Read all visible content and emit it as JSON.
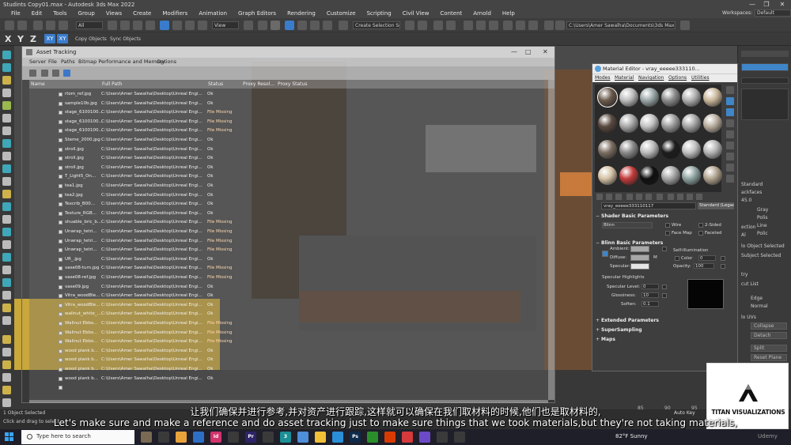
{
  "window": {
    "title": "Studints Copy01.max - Autodesk 3ds Max 2022",
    "controls": [
      "—",
      "❐",
      "✕"
    ]
  },
  "menubar": {
    "items": [
      "File",
      "Edit",
      "Tools",
      "Group",
      "Views",
      "Create",
      "Modifiers",
      "Animation",
      "Graph Editors",
      "Rendering",
      "Customize",
      "Scripting",
      "Civil View",
      "Content",
      "Arnold",
      "Help"
    ],
    "workspaces_label": "Workspaces:",
    "workspace_value": "Default"
  },
  "toolbar": {
    "selection_filter": "All",
    "view_dropdown": "View",
    "selection_set": "Create Selection Se",
    "project_path": "C:\\Users\\Amer Sawalha\\Documents\\3ds Max 2022"
  },
  "toolbar2": {
    "axes": [
      "X",
      "Y",
      "Z"
    ],
    "xy_buttons": [
      "XY",
      "XY"
    ],
    "tabs": [
      "Copy Objects",
      "Sync Objects"
    ]
  },
  "asset_tracking": {
    "title": "Asset Tracking",
    "menu": [
      "Server",
      "File",
      "Paths",
      "Bitmap Performance and Memory",
      "Options"
    ],
    "columns": [
      "Name",
      "Full Path",
      "Status",
      "Proxy Resol...",
      "Proxy Status"
    ],
    "rows": [
      {
        "name": "rtom_ref.jpg",
        "path": "C:\\Users\\Amer Sawalha\\Desktop\\Unreal Engi...",
        "status": "Ok"
      },
      {
        "name": "sample10b.jpg",
        "path": "C:\\Users\\Amer Sawalha\\Desktop\\Unreal Engi...",
        "status": "Ok"
      },
      {
        "name": "stage_6100100...",
        "path": "C:\\Users\\Amer Sawalha\\Desktop\\Unreal Engi...",
        "status": "File Missing"
      },
      {
        "name": "stage_6100100...",
        "path": "C:\\Users\\Amer Sawalha\\Desktop\\Unreal Engi...",
        "status": "File Missing"
      },
      {
        "name": "stage_6100100...",
        "path": "C:\\Users\\Amer Sawalha\\Desktop\\Unreal Engi...",
        "status": "File Missing"
      },
      {
        "name": "Steme_2000.jpg",
        "path": "C:\\Users\\Amer Sawalha\\Desktop\\Unreal Engi...",
        "status": "Ok"
      },
      {
        "name": "stroll.jpg",
        "path": "C:\\Users\\Amer Sawalha\\Desktop\\Unreal Engi...",
        "status": "Ok"
      },
      {
        "name": "stroll.jpg",
        "path": "C:\\Users\\Amer Sawalha\\Desktop\\Unreal Engi...",
        "status": "Ok"
      },
      {
        "name": "stroll.jpg",
        "path": "C:\\Users\\Amer Sawalha\\Desktop\\Unreal Engi...",
        "status": "Ok"
      },
      {
        "name": "T_Light5_On...",
        "path": "C:\\Users\\Amer Sawalha\\Desktop\\Unreal Engi...",
        "status": "Ok"
      },
      {
        "name": "tea1.jpg",
        "path": "C:\\Users\\Amer Sawalha\\Desktop\\Unreal Engi...",
        "status": "Ok"
      },
      {
        "name": "tea2.jpg",
        "path": "C:\\Users\\Amer Sawalha\\Desktop\\Unreal Engi...",
        "status": "Ok"
      },
      {
        "name": "Texcrib_B00...",
        "path": "C:\\Users\\Amer Sawalha\\Desktop\\Unreal Engi...",
        "status": "Ok"
      },
      {
        "name": "Texture_RGB...",
        "path": "C:\\Users\\Amer Sawalha\\Desktop\\Unreal Engi...",
        "status": "Ok"
      },
      {
        "name": "shuable_bric_b...",
        "path": "C:\\Users\\Amer Sawalha\\Desktop\\Unreal Engi...",
        "status": "File Missing"
      },
      {
        "name": "Unwrap_tetri...",
        "path": "C:\\Users\\Amer Sawalha\\Desktop\\Unreal Engi...",
        "status": "File Missing"
      },
      {
        "name": "Unwrap_tetri...",
        "path": "C:\\Users\\Amer Sawalha\\Desktop\\Unreal Engi...",
        "status": "File Missing"
      },
      {
        "name": "Unwrap_tetri...",
        "path": "C:\\Users\\Amer Sawalha\\Desktop\\Unreal Engi...",
        "status": "File Missing"
      },
      {
        "name": "UR_.jpg",
        "path": "C:\\Users\\Amer Sawalha\\Desktop\\Unreal Engi...",
        "status": "Ok"
      },
      {
        "name": "vase08-turn.jpg",
        "path": "C:\\Users\\Amer Sawalha\\Desktop\\Unreal Engi...",
        "status": "File Missing"
      },
      {
        "name": "vase08-ref.jpg",
        "path": "C:\\Users\\Amer Sawalha\\Desktop\\Unreal Engi...",
        "status": "File Missing"
      },
      {
        "name": "vase09.jpg",
        "path": "C:\\Users\\Amer Sawalha\\Desktop\\Unreal Engi...",
        "status": "Ok"
      },
      {
        "name": "Vitra_woodBle...",
        "path": "C:\\Users\\Amer Sawalha\\Desktop\\Unreal Engi...",
        "status": "Ok"
      },
      {
        "name": "Vitra_woodBle...",
        "path": "C:\\Users\\Amer Sawalha\\Desktop\\Unreal Engi...",
        "status": "Ok"
      },
      {
        "name": "wallnut_white_...",
        "path": "C:\\Users\\Amer Sawalha\\Desktop\\Unreal Engi...",
        "status": "Ok"
      },
      {
        "name": "Wallnut Ebbo...",
        "path": "C:\\Users\\Amer Sawalha\\Desktop\\Unreal Engi...",
        "status": "File Missing"
      },
      {
        "name": "Wallnut Ebbo...",
        "path": "C:\\Users\\Amer Sawalha\\Desktop\\Unreal Engi...",
        "status": "File Missing"
      },
      {
        "name": "Wallnut Ebbo...",
        "path": "C:\\Users\\Amer Sawalha\\Desktop\\Unreal Engi...",
        "status": "File Missing"
      },
      {
        "name": "wood plank b...",
        "path": "C:\\Users\\Amer Sawalha\\Desktop\\Unreal Engi...",
        "status": "Ok"
      },
      {
        "name": "wood plank b...",
        "path": "C:\\Users\\Amer Sawalha\\Desktop\\Unreal Engi...",
        "status": "Ok"
      },
      {
        "name": "wood plank b...",
        "path": "C:\\Users\\Amer Sawalha\\Desktop\\Unreal Engi...",
        "status": "Ok"
      },
      {
        "name": "wood plank b...",
        "path": "C:\\Users\\Amer Sawalha\\Desktop\\Unreal Engi...",
        "status": "Ok"
      },
      {
        "name": "",
        "path": "",
        "status": ""
      }
    ]
  },
  "material_editor": {
    "title": "Material Editor - vray_eeeee333110...",
    "menu": [
      "Modes",
      "Material",
      "Navigation",
      "Options",
      "Utilities"
    ],
    "material_name": "vray_eeeee333110117",
    "material_type": "Standard (Legacy)",
    "rollouts": {
      "shader_basic": "Shader Basic Parameters",
      "blinn_basic": "Blinn Basic Parameters",
      "extended": "Extended Parameters",
      "supersampling": "SuperSampling",
      "maps": "Maps"
    },
    "shader": {
      "type": "Blinn",
      "wire": "Wire",
      "two_sided": "2-Sided",
      "face_map": "Face Map",
      "faceted": "Faceted"
    },
    "blinn": {
      "ambient": "Ambient:",
      "diffuse": "Diffuse:",
      "specular": "Specular:",
      "m_label": "M",
      "self_illumination": "Self-Illumination",
      "color_label": "Color",
      "color_value": "0",
      "opacity_label": "Opacity:",
      "opacity_value": "100",
      "specular_highlights": "Specular Highlights",
      "specular_level_label": "Specular Level:",
      "specular_level": "0",
      "glossiness_label": "Glossiness:",
      "glossiness": "10",
      "soften_label": "Soften:",
      "soften": "0.1"
    },
    "slot_colors": [
      "#6a5a4c",
      "#bdbdbd",
      "#9aa6a6",
      "#8b8b8b",
      "#b0b0b0",
      "#c9b69a",
      "#5a4a40",
      "#a8a8a8",
      "#c2c2c2",
      "#9c9c9c",
      "#a5a5a5",
      "#b8ad9c",
      "#7b6e62",
      "#8a8a8a",
      "#bcbcbc",
      "#1c1c1c",
      "#c0c0c0",
      "#b5b5b5",
      "#d4c2a5",
      "#c23b3b",
      "#0f0f0f",
      "#a5a5a5",
      "#8ea3a0",
      "#b0a38e"
    ]
  },
  "command_panel": {
    "labels": [
      "Standard",
      "ackfaces",
      "45.0",
      "Gray",
      "Polis",
      "Line",
      "Polic",
      "ection",
      "Al",
      "lo Object Selected",
      "Subject Selected",
      "try",
      "cut List",
      "Edge",
      "Normal",
      "lo UVs",
      "Collapse",
      "Detach",
      "Split",
      "Reset Plane"
    ]
  },
  "status": {
    "line1": "1 Object Selected",
    "line2": "Click and drag to select",
    "auto_key": "Auto Key",
    "frame_ticks": [
      "85",
      "90",
      "95"
    ]
  },
  "logo": {
    "text": "TITAN VISUALIZATIONS"
  },
  "subtitles": {
    "chinese": "让我们确保并进行参考,并对资产进行跟踪,这样就可以确保在我们取材料的时候,他们也是取材料的,",
    "english": "Let's make sure and make a reference and do asset tracking just to make sure things that we took materials,but they're not taking materials,"
  },
  "taskbar": {
    "search_placeholder": "Type here to search",
    "weather": "82°F Sunny",
    "watermark": "Udemy",
    "apps": [
      {
        "label": "",
        "color": "#7a6a54"
      },
      {
        "label": "",
        "color": "#3a3a3a"
      },
      {
        "label": "",
        "color": "#e8a23a"
      },
      {
        "label": "",
        "color": "#2d6fc7"
      },
      {
        "label": "Id",
        "color": "#d1336a"
      },
      {
        "label": "",
        "color": "#3a3a3a"
      },
      {
        "label": "Pr",
        "color": "#2e2468"
      },
      {
        "label": "",
        "color": "#3a3a3a"
      },
      {
        "label": "3",
        "color": "#1b8f96"
      },
      {
        "label": "",
        "color": "#4f8ed8"
      },
      {
        "label": "",
        "color": "#f2c037"
      },
      {
        "label": "",
        "color": "#2a8fd8"
      },
      {
        "label": "Ps",
        "color": "#0f2a4a"
      },
      {
        "label": "",
        "color": "#2a8f2a"
      },
      {
        "label": "",
        "color": "#d83b01"
      },
      {
        "label": "",
        "color": "#d63a3a"
      },
      {
        "label": "",
        "color": "#6c4ac7"
      },
      {
        "label": "",
        "color": "#3a3a3a"
      },
      {
        "label": "",
        "color": "#3a3a3a"
      }
    ]
  }
}
